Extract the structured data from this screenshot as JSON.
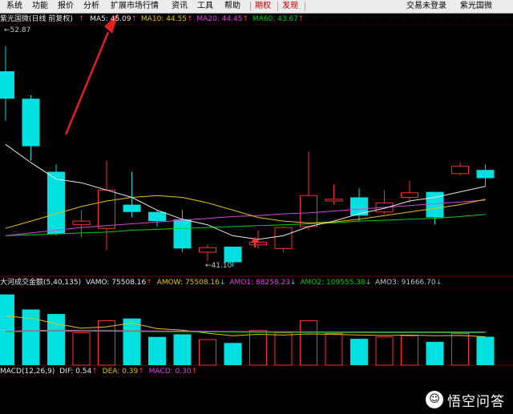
{
  "menu": {
    "items": [
      "系统",
      "功能",
      "报价",
      "分析",
      "扩展市场行情",
      "资讯",
      "工具",
      "帮助"
    ],
    "tabs": [
      "期权",
      "发现"
    ],
    "login_status": "交易未登录",
    "stock_name": "紫光国微"
  },
  "main_chart": {
    "title": "紫光国微(日线 前复权)",
    "ma": [
      {
        "label": "MA5: 45.09",
        "color": "#e8e8e8"
      },
      {
        "label": "MA10: 44.55",
        "color": "#e5c300"
      },
      {
        "label": "MA20: 44.45",
        "color": "#e040e0"
      },
      {
        "label": "MA60: 43.67",
        "color": "#00d000"
      }
    ],
    "high_label": "52.87",
    "low_label": "41.10"
  },
  "vol_chart": {
    "title": "大河成交金额(5,40,135)",
    "items": [
      {
        "label": "VAMO: 75508.16",
        "arrow": "up",
        "color": "#e8e8e8"
      },
      {
        "label": "AMOW: 75508.16",
        "arrow": "down",
        "color": "#e5c300"
      },
      {
        "label": "AMO1: 88258.23",
        "arrow": "down",
        "color": "#e040e0"
      },
      {
        "label": "AMO2: 109555.38",
        "arrow": "down",
        "color": "#00d000"
      },
      {
        "label": "AMO3: 91666.70",
        "arrow": "down",
        "color": "#c0c0c0"
      }
    ]
  },
  "macd_chart": {
    "title": "MACD(12,26,9)",
    "items": [
      {
        "label": "DIF: 0.54",
        "arrow": "up",
        "color": "#e8e8e8"
      },
      {
        "label": "DEA: 0.39",
        "arrow": "up",
        "color": "#e5c300"
      },
      {
        "label": "MACD: 0.30",
        "arrow": "up",
        "color": "#e040e0"
      }
    ]
  },
  "watermark": {
    "text": "悟空问答"
  },
  "colors": {
    "up": "#ff3030",
    "down": "#00e0e0",
    "bg": "#000000"
  },
  "chart_data": {
    "type": "candlestick",
    "price_ylim": [
      40.5,
      54.0
    ],
    "candles": [
      {
        "o": 51.5,
        "h": 52.87,
        "l": 48.8,
        "c": 50.0
      },
      {
        "o": 50.0,
        "h": 50.2,
        "l": 46.6,
        "c": 47.4
      },
      {
        "o": 46.0,
        "h": 46.4,
        "l": 42.5,
        "c": 42.6
      },
      {
        "o": 43.1,
        "h": 43.9,
        "l": 42.4,
        "c": 43.3
      },
      {
        "o": 42.9,
        "h": 46.6,
        "l": 41.7,
        "c": 45.0
      },
      {
        "o": 44.2,
        "h": 46.0,
        "l": 43.5,
        "c": 43.8
      },
      {
        "o": 43.8,
        "h": 43.9,
        "l": 43.0,
        "c": 43.3
      },
      {
        "o": 43.4,
        "h": 43.9,
        "l": 41.6,
        "c": 41.8
      },
      {
        "o": 41.6,
        "h": 42.0,
        "l": 41.1,
        "c": 41.85
      },
      {
        "o": 41.9,
        "h": 41.9,
        "l": 40.8,
        "c": 41.05
      },
      {
        "o": 42.0,
        "h": 42.8,
        "l": 41.8,
        "c": 42.15
      },
      {
        "o": 41.8,
        "h": 43.0,
        "l": 41.6,
        "c": 42.95
      },
      {
        "o": 43.0,
        "h": 47.1,
        "l": 42.8,
        "c": 44.7
      },
      {
        "o": 44.4,
        "h": 45.3,
        "l": 44.2,
        "c": 44.5
      },
      {
        "o": 44.6,
        "h": 45.1,
        "l": 43.3,
        "c": 43.6
      },
      {
        "o": 43.8,
        "h": 45.0,
        "l": 43.7,
        "c": 44.3
      },
      {
        "o": 44.6,
        "h": 45.5,
        "l": 44.3,
        "c": 44.85
      },
      {
        "o": 44.9,
        "h": 44.9,
        "l": 43.1,
        "c": 43.5
      },
      {
        "o": 45.9,
        "h": 46.5,
        "l": 45.8,
        "c": 46.3
      },
      {
        "o": 46.1,
        "h": 46.4,
        "l": 45.2,
        "c": 45.65
      }
    ],
    "ma5": [
      47.5,
      46.5,
      45.6,
      45.4,
      45.0,
      44.6,
      43.9,
      43.4,
      43.1,
      42.5,
      42.3,
      42.5,
      43.0,
      43.3,
      43.7,
      44.0,
      44.4,
      44.6,
      44.9,
      45.2
    ],
    "ma10": [
      42.9,
      43.3,
      43.7,
      44.1,
      44.4,
      44.6,
      44.7,
      44.6,
      44.3,
      43.9,
      43.5,
      43.3,
      43.2,
      43.25,
      43.4,
      43.6,
      43.8,
      44.0,
      44.2,
      44.5
    ],
    "ma20": [
      42.5,
      42.65,
      42.8,
      42.95,
      43.05,
      43.15,
      43.25,
      43.35,
      43.45,
      43.55,
      43.6,
      43.7,
      43.75,
      43.85,
      43.95,
      44.05,
      44.15,
      44.25,
      44.35,
      44.45
    ],
    "ma60": [
      42.5,
      42.55,
      42.6,
      42.65,
      42.7,
      42.8,
      42.85,
      42.9,
      42.95,
      43.0,
      43.05,
      43.1,
      43.15,
      43.2,
      43.3,
      43.35,
      43.4,
      43.45,
      43.55,
      43.67
    ],
    "volumes": [
      188000,
      148000,
      136000,
      86000,
      118000,
      124000,
      75000,
      82000,
      68000,
      59000,
      92000,
      86000,
      118000,
      84000,
      70000,
      75000,
      78000,
      62000,
      84000,
      75508
    ],
    "vol_ylim": [
      0,
      200000
    ],
    "vamo_line": [
      130000,
      125000,
      110000,
      98000,
      102000,
      112000,
      97000,
      93000,
      85000,
      78000,
      82000,
      80000,
      83000,
      82000,
      80000,
      79000,
      80000,
      78000,
      79000,
      75508
    ],
    "amo_line": [
      90000,
      92000,
      93000,
      92000,
      92000,
      91500,
      91000,
      90500,
      90000,
      89500,
      89000,
      88800,
      88700,
      88600,
      88500,
      88400,
      88300,
      88300,
      88250,
      88258
    ]
  }
}
